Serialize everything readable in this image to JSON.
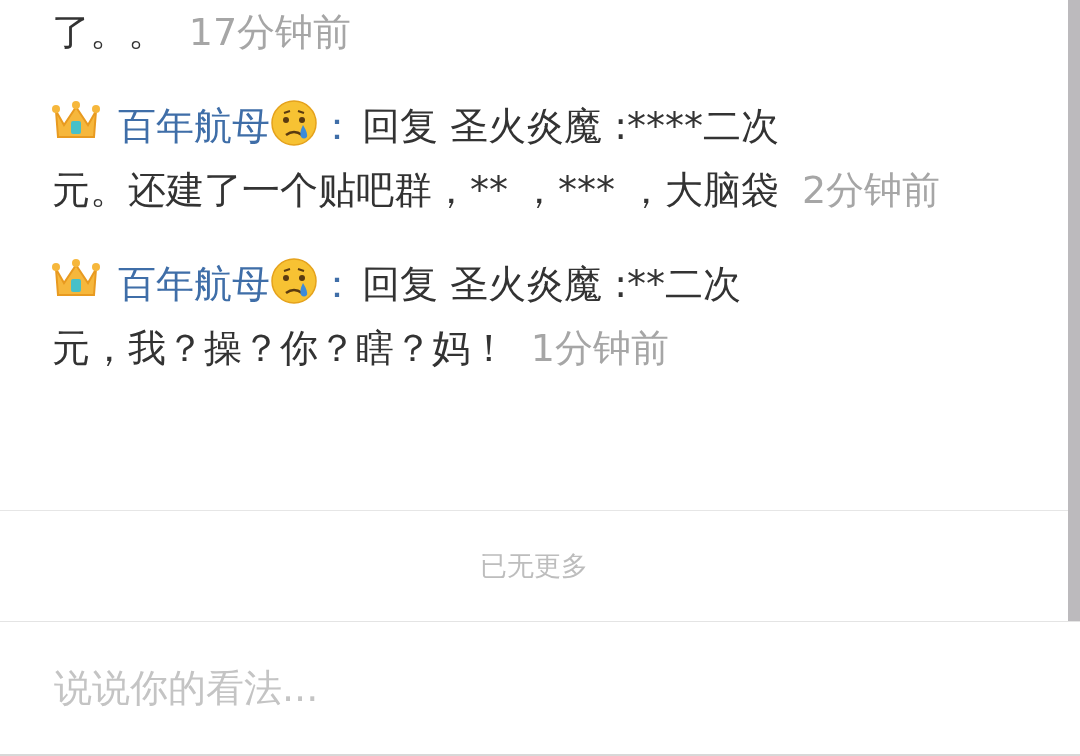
{
  "comments": [
    {
      "text": [
        "了。。"
      ],
      "time": "17分钟前"
    },
    {
      "user": "百年航母",
      "separator": "：",
      "text": [
        "回复 圣火炎魔 :****二次",
        "元。还建了一个贴吧群，** ，*** ，大脑袋"
      ],
      "time": "2分钟前"
    },
    {
      "user": "百年航母",
      "separator": "：",
      "text": [
        "回复 圣火炎魔 :**二次",
        "元，我？操？你？瞎？妈！"
      ],
      "time": "1分钟前"
    }
  ],
  "end_label": "已无更多",
  "input": {
    "placeholder": "说说你的看法..."
  }
}
